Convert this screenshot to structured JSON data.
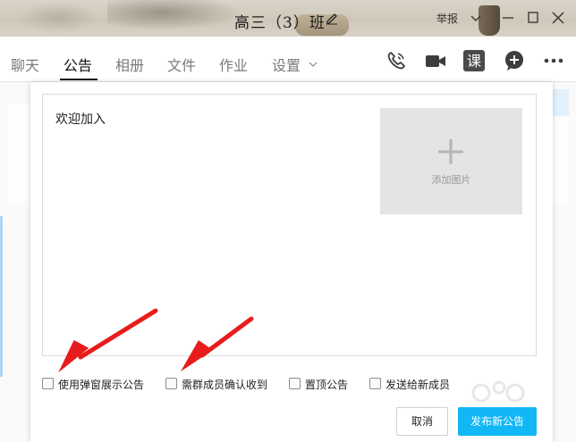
{
  "window": {
    "title": "高三（3）班",
    "report_label": "举报"
  },
  "tabs": [
    {
      "label": "聊天"
    },
    {
      "label": "公告"
    },
    {
      "label": "相册"
    },
    {
      "label": "文件"
    },
    {
      "label": "作业"
    },
    {
      "label": "设置"
    }
  ],
  "active_tab": "公告",
  "toolbar": {
    "course_label": "课"
  },
  "dialog": {
    "editor_text": "欢迎加入",
    "add_image_label": "添加图片",
    "options": [
      {
        "label": "使用弹窗展示公告",
        "checked": false
      },
      {
        "label": "需群成员确认收到",
        "checked": false
      },
      {
        "label": "置顶公告",
        "checked": false
      },
      {
        "label": "发送给新成员",
        "checked": false
      }
    ],
    "cancel_label": "取消",
    "publish_label": "发布新公告"
  },
  "colors": {
    "accent": "#12b7f5",
    "arrow": "#e81c1c"
  },
  "icons": [
    "edit-icon",
    "chevron-down-icon",
    "minimize-icon",
    "maximize-icon",
    "close-icon",
    "phone-icon",
    "video-icon",
    "course-icon",
    "add-icon",
    "more-icon",
    "plus-icon"
  ]
}
